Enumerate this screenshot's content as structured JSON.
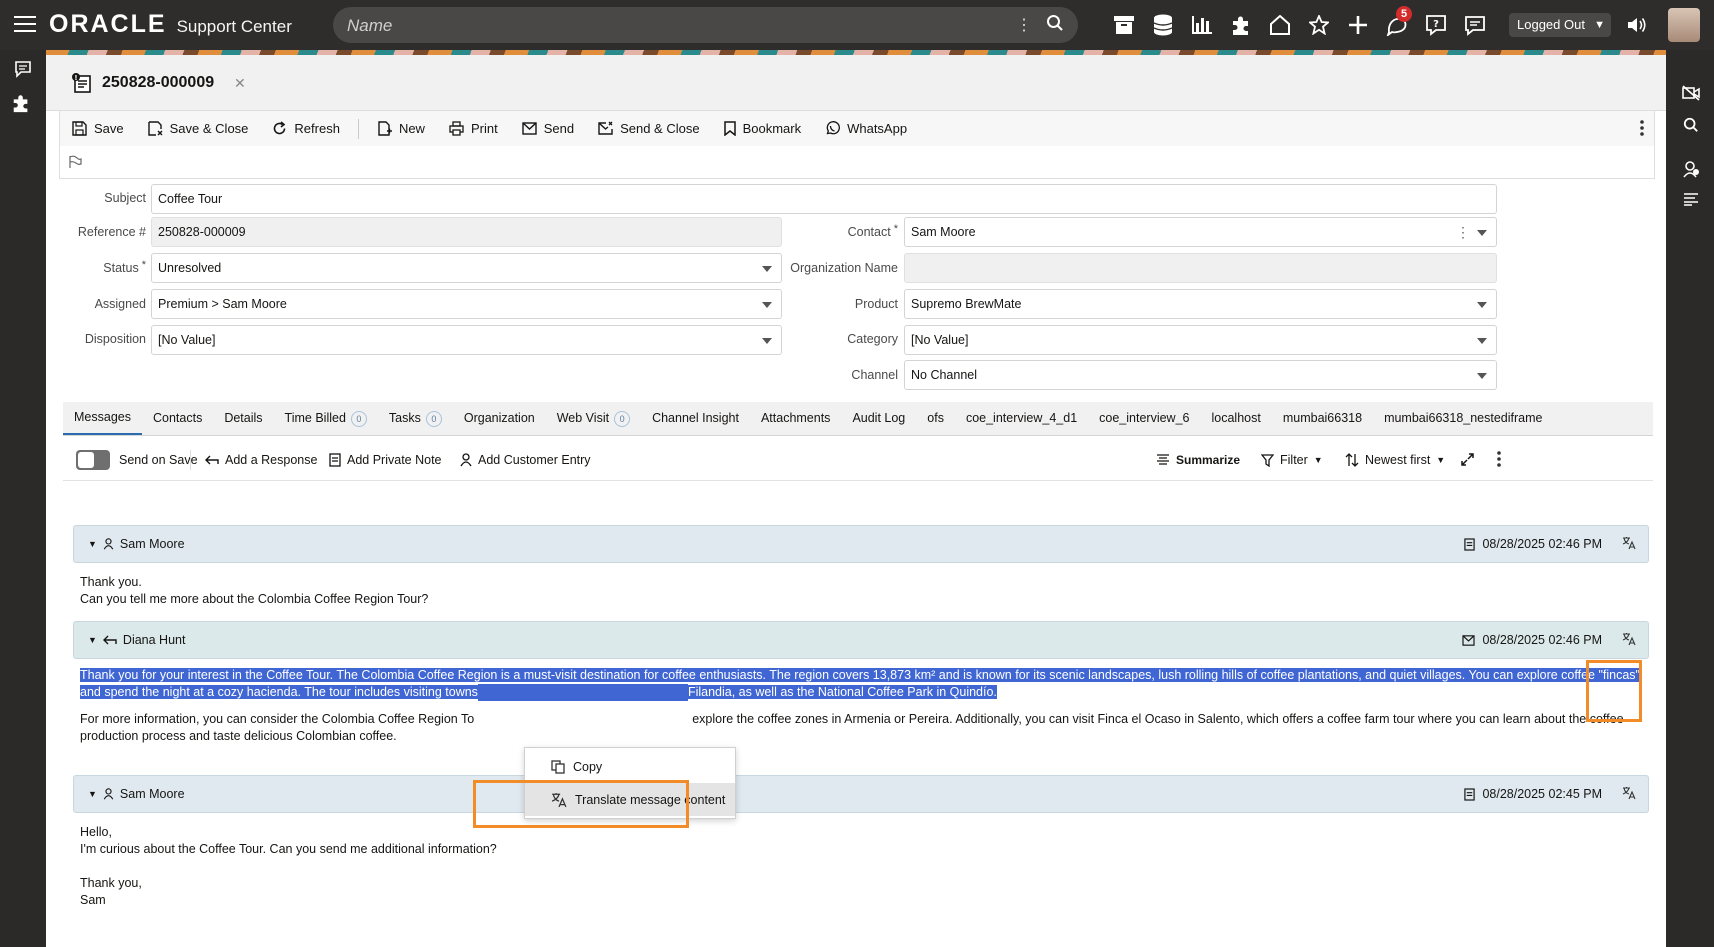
{
  "topbar": {
    "brand": "ORACLE",
    "product": "Support Center",
    "search_placeholder": "Name",
    "notification_count": "5",
    "status": "Logged Out"
  },
  "case": {
    "reference": "250828-000009"
  },
  "toolbar": {
    "save": "Save",
    "save_close": "Save & Close",
    "refresh": "Refresh",
    "new": "New",
    "print": "Print",
    "send": "Send",
    "send_close": "Send & Close",
    "bookmark": "Bookmark",
    "whatsapp": "WhatsApp"
  },
  "form": {
    "subject_label": "Subject",
    "subject": "Coffee Tour",
    "reference_label": "Reference #",
    "reference": "250828-000009",
    "status_label": "Status",
    "status": "Unresolved",
    "assigned_label": "Assigned",
    "assigned": "Premium > Sam Moore",
    "disposition_label": "Disposition",
    "disposition": "[No Value]",
    "contact_label": "Contact",
    "contact": "Sam Moore",
    "org_label": "Organization Name",
    "org": "",
    "product_label": "Product",
    "product": "Supremo BrewMate",
    "category_label": "Category",
    "category": "[No Value]",
    "channel_label": "Channel",
    "channel": "No Channel",
    "required_mark": "*"
  },
  "tabs": [
    {
      "label": "Messages"
    },
    {
      "label": "Contacts"
    },
    {
      "label": "Details"
    },
    {
      "label": "Time Billed",
      "count": "0"
    },
    {
      "label": "Tasks",
      "count": "0"
    },
    {
      "label": "Organization"
    },
    {
      "label": "Web Visit",
      "count": "0"
    },
    {
      "label": "Channel Insight"
    },
    {
      "label": "Attachments"
    },
    {
      "label": "Audit Log"
    },
    {
      "label": "ofs"
    },
    {
      "label": "coe_interview_4_d1"
    },
    {
      "label": "coe_interview_6"
    },
    {
      "label": "localhost"
    },
    {
      "label": "mumbai66318"
    },
    {
      "label": "mumbai66318_nestediframe"
    }
  ],
  "messages_toolbar": {
    "send_on_save": "Send on Save",
    "add_response": "Add a Response",
    "add_private_note": "Add Private Note",
    "add_customer_entry": "Add Customer Entry",
    "summarize": "Summarize",
    "filter": "Filter",
    "sort": "Newest first"
  },
  "messages": [
    {
      "author": "Sam Moore",
      "date": "08/28/2025 02:46 PM",
      "lines": [
        "Thank you.",
        "Can you tell me more about the Colombia Coffee Region Tour?"
      ]
    },
    {
      "author": "Diana Hunt",
      "date": "08/28/2025 02:46 PM",
      "selected_line1": "Thank you for your interest in the Coffee Tour. The Colombia Coffee Region is a must-visit destination for coffee enthusiasts. The region covers 13,873 km² and is known for its scenic landscapes, lush rolling hills of coffee plantations, and quiet villages. You can explore coffee \"fincas\"",
      "selected_line2a": "and spend the night at a cozy hacienda. The tour includes visiting towns",
      "selected_line2b": "Filandia, as well as the National Coffee Park in Quindío.",
      "para2_line1a": "For more information, you can consider the Colombia Coffee Region To",
      "para2_line1b": "explore the coffee zones in Armenia or Pereira. Additionally, you can visit Finca el Ocaso in Salento, which offers a coffee farm tour where you can learn about the coffee",
      "para2_line2": "production process and taste delicious Colombian coffee."
    },
    {
      "author": "Sam Moore",
      "date": "08/28/2025 02:45 PM",
      "lines": [
        "Hello,",
        "I'm curious about the Coffee Tour. Can you send me additional information?",
        "",
        "Thank you,",
        "Sam"
      ]
    }
  ],
  "context_menu": {
    "copy": "Copy",
    "translate": "Translate message content"
  },
  "colors": {
    "highlight": "#f28c28",
    "selection": "#3f66d3",
    "badge": "#d42b2b"
  }
}
